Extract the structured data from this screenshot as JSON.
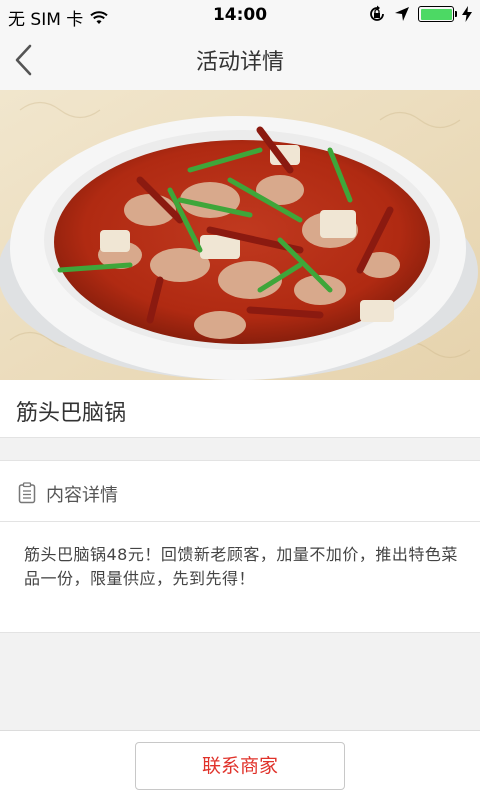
{
  "status_bar": {
    "carrier": "无 SIM 卡",
    "time": "14:00",
    "icons": [
      "wifi-icon",
      "rotation-lock-icon",
      "location-arrow-icon",
      "battery-icon",
      "charging-bolt-icon"
    ],
    "battery_level": 1.0,
    "battery_color": "#4cd964"
  },
  "nav": {
    "title": "活动详情",
    "back_icon": "chevron-left-icon"
  },
  "hero_image": {
    "subject": "bowl of spicy beef hot pot"
  },
  "dish": {
    "name": "筋头巴脑锅"
  },
  "content": {
    "section_icon": "clipboard-icon",
    "section_title": "内容详情",
    "description": "筋头巴脑锅48元！回馈新老顾客，加量不加价，推出特色菜品一份，限量供应，先到先得！"
  },
  "footer": {
    "contact_label": "联系商家",
    "accent_color": "#e0322a"
  }
}
